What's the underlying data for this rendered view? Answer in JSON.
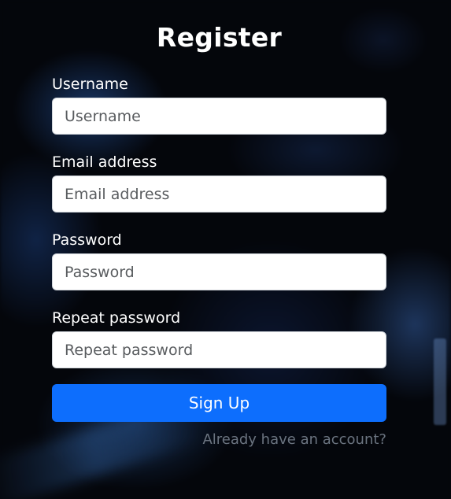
{
  "form": {
    "title": "Register",
    "fields": [
      {
        "label": "Username",
        "placeholder": "Username",
        "value": ""
      },
      {
        "label": "Email address",
        "placeholder": "Email address",
        "value": ""
      },
      {
        "label": "Password",
        "placeholder": "Password",
        "value": ""
      },
      {
        "label": "Repeat password",
        "placeholder": "Repeat password",
        "value": ""
      }
    ],
    "submit_label": "Sign Up",
    "login_link": "Already have an account?"
  },
  "colors": {
    "primary_button": "#0d6efd",
    "background": "#04060b",
    "link": "#6b7480"
  }
}
